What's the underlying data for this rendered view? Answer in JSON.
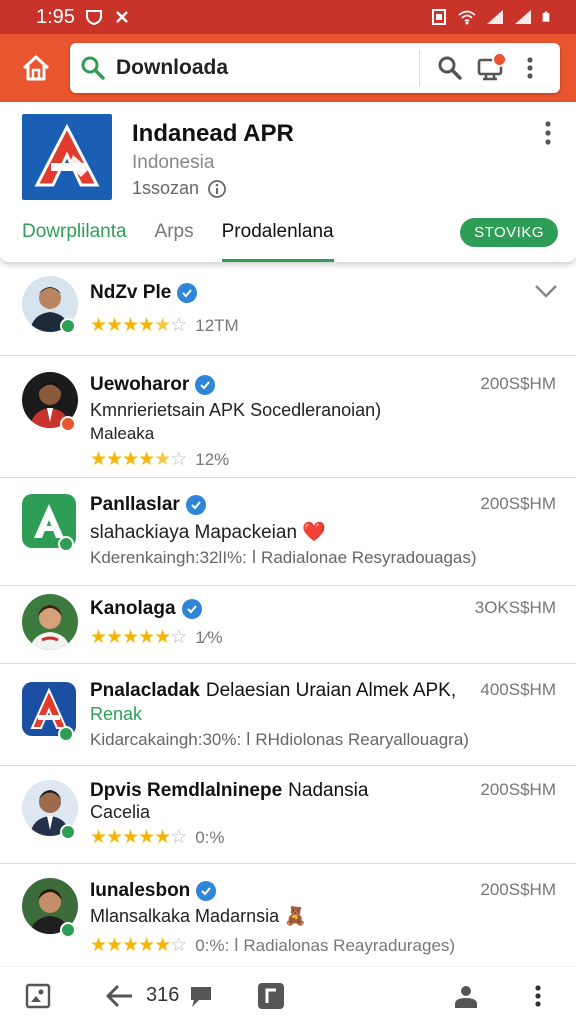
{
  "status": {
    "time": "1:95"
  },
  "search": {
    "query": "Downloada"
  },
  "app": {
    "title": "Indanead APR",
    "subtitle": "Indonesia",
    "meta": "1ssozan"
  },
  "tabs": [
    "Dowrplilanta",
    "Arps",
    "Prodalenlana"
  ],
  "show_button": "STOVIKG",
  "rows": [
    {
      "name": "NdZv Ple",
      "verified": true,
      "stars": 4.5,
      "value": "12TM",
      "right": ""
    },
    {
      "name": "Uewoharor",
      "verified": true,
      "line1": "Kmnrierietsain APK Socedleranoian)",
      "line2": "Maleaka",
      "stars": 4.5,
      "value": "12%",
      "right": "200S$HM"
    },
    {
      "name": "Panllaslar",
      "verified": true,
      "line1": "slahackiaya Mapackeian ❤️",
      "grey": "Kderenkaingh:32lI%: ⅼ Radialonae Resyradouagas)",
      "right": "200S$HM"
    },
    {
      "name": "Kanolaga",
      "verified": true,
      "stars": 5,
      "value": "1⁄%",
      "right": "3OKS$HM"
    },
    {
      "name": "Pnalacladak",
      "tail": " Delaesian Uraian Almek APK,",
      "line1": "Renak",
      "grey": "Kidarcakaingh:30%: ⅼ RHdiolonas Rearyallouagra)",
      "right": "400S$HM"
    },
    {
      "name": "Dpvis Remdlalninepe",
      "tail": " Nadansia",
      "line1": "Cacelia",
      "stars": 5,
      "value": "0:%",
      "right": "200S$HM"
    },
    {
      "name": "Iunalesbon",
      "verified": true,
      "line1": "Mlansalkaka Madarnsia 🧸",
      "stars": 5,
      "value": "0:%: ⅼ Radialonas Reayradurages)",
      "right": "200S$HM"
    }
  ],
  "bottom": {
    "count": "316"
  },
  "colors": {
    "accent": "#e9552f",
    "status": "#c8332a",
    "green": "#2e9e57",
    "star": "#f4b400",
    "verified": "#2f86d6"
  },
  "icons": [
    "home-icon",
    "search-icon",
    "cart-icon",
    "more-vert-icon",
    "info-icon",
    "verified-icon",
    "chevron-down-icon",
    "share-icon",
    "comment-icon",
    "bookmark-icon",
    "person-icon"
  ]
}
